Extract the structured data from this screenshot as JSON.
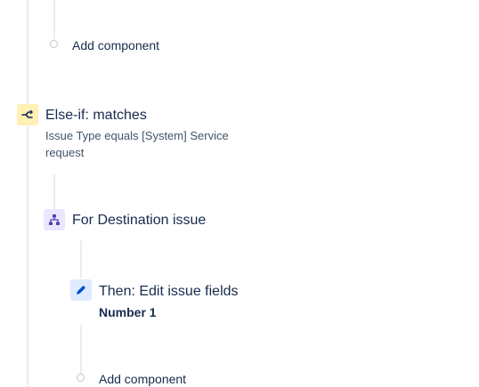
{
  "components": {
    "add_component_top": {
      "label": "Add component"
    },
    "else_if": {
      "icon": "branch-icon",
      "title": "Else-if: matches",
      "description": "Issue Type equals [System] Service request"
    },
    "for_branch": {
      "icon": "hierarchy-icon",
      "title": "For Destination issue"
    },
    "edit_action": {
      "icon": "pencil-icon",
      "title": "Then: Edit issue fields",
      "detail": "Number 1"
    },
    "add_component_bottom": {
      "label": "Add component"
    }
  },
  "colors": {
    "condition_bg": "#fff0b3",
    "branch_bg": "#eae6ff",
    "action_bg": "#deebff",
    "connector_line": "#ebecf0"
  }
}
